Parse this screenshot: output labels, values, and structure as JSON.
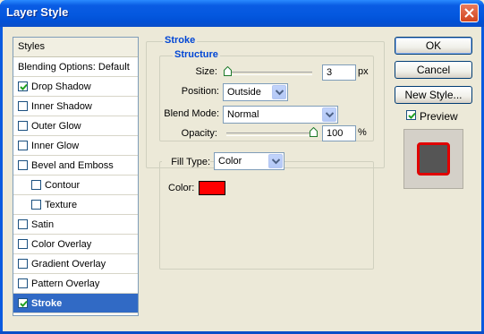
{
  "window": {
    "title": "Layer Style"
  },
  "styles_panel": {
    "header": "Styles",
    "items": [
      {
        "label": "Blending Options: Default",
        "checkbox": false,
        "checked": false,
        "indent": false,
        "selected": false
      },
      {
        "label": "Drop Shadow",
        "checkbox": true,
        "checked": true,
        "indent": false,
        "selected": false
      },
      {
        "label": "Inner Shadow",
        "checkbox": true,
        "checked": false,
        "indent": false,
        "selected": false
      },
      {
        "label": "Outer Glow",
        "checkbox": true,
        "checked": false,
        "indent": false,
        "selected": false
      },
      {
        "label": "Inner Glow",
        "checkbox": true,
        "checked": false,
        "indent": false,
        "selected": false
      },
      {
        "label": "Bevel and Emboss",
        "checkbox": true,
        "checked": false,
        "indent": false,
        "selected": false
      },
      {
        "label": "Contour",
        "checkbox": true,
        "checked": false,
        "indent": true,
        "selected": false
      },
      {
        "label": "Texture",
        "checkbox": true,
        "checked": false,
        "indent": true,
        "selected": false
      },
      {
        "label": "Satin",
        "checkbox": true,
        "checked": false,
        "indent": false,
        "selected": false
      },
      {
        "label": "Color Overlay",
        "checkbox": true,
        "checked": false,
        "indent": false,
        "selected": false
      },
      {
        "label": "Gradient Overlay",
        "checkbox": true,
        "checked": false,
        "indent": false,
        "selected": false
      },
      {
        "label": "Pattern Overlay",
        "checkbox": true,
        "checked": false,
        "indent": false,
        "selected": false
      },
      {
        "label": "Stroke",
        "checkbox": true,
        "checked": true,
        "indent": false,
        "selected": true
      }
    ]
  },
  "stroke": {
    "group_title": "Stroke",
    "structure_title": "Structure",
    "size": {
      "label": "Size:",
      "value": "3",
      "unit": "px",
      "slider_fraction": 0.0
    },
    "position": {
      "label": "Position:",
      "value": "Outside"
    },
    "blend_mode": {
      "label": "Blend Mode:",
      "value": "Normal"
    },
    "opacity": {
      "label": "Opacity:",
      "value": "100",
      "unit": "%",
      "slider_fraction": 1.0
    },
    "fill_type": {
      "label": "Fill Type:",
      "value": "Color"
    },
    "color": {
      "label": "Color:",
      "hex": "#ff0000"
    }
  },
  "buttons": {
    "ok": "OK",
    "cancel": "Cancel",
    "new_style": "New Style..."
  },
  "preview": {
    "label": "Preview",
    "checked": true,
    "fill": "#555555",
    "stroke": "#e00000"
  },
  "colors": {
    "accent": "#316ac5",
    "title_blue": "#0046d5",
    "stroke_color": "#ff0000"
  }
}
